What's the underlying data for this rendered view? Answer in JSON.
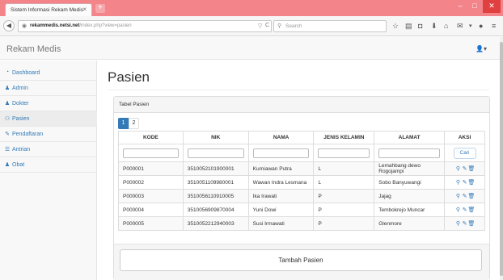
{
  "browser": {
    "tab_title": "Sistem Informasi Rekam Medis",
    "url_host": "rekammedis.netsi.net",
    "url_path": "/index.php?view=pasien",
    "search_placeholder": "Search"
  },
  "app": {
    "brand": "Rekam Medis"
  },
  "sidebar": {
    "items": [
      {
        "label": "Dashboard",
        "icon": "dashboard-icon"
      },
      {
        "label": "Admin",
        "icon": "user-icon"
      },
      {
        "label": "Dokter",
        "icon": "user-icon"
      },
      {
        "label": "Pasien",
        "icon": "users-icon"
      },
      {
        "label": "Pendaftaran",
        "icon": "edit-icon"
      },
      {
        "label": "Antrian",
        "icon": "list-icon"
      },
      {
        "label": "Obat",
        "icon": "user-icon"
      }
    ]
  },
  "main": {
    "title": "Pasien",
    "panel_title": "Tabel Pasien",
    "pagination": [
      "1",
      "2"
    ],
    "columns": [
      "KODE",
      "NIK",
      "NAMA",
      "JENIS KELAMIN",
      "ALAMAT",
      "AKSI"
    ],
    "search_button": "Cari",
    "rows": [
      {
        "kode": "P000001",
        "nik": "3510052101900001",
        "nama": "Kurniawan Putra",
        "jk": "L",
        "alamat": "Lemahbang dewo Rogojampi"
      },
      {
        "kode": "P000002",
        "nik": "3510051109980001",
        "nama": "Wawan Indra Lesmana",
        "jk": "L",
        "alamat": "Sobo Banyuwangi"
      },
      {
        "kode": "P000003",
        "nik": "3510056110910005",
        "nama": "Ika Irawati",
        "jk": "P",
        "alamat": "Jajag"
      },
      {
        "kode": "P000004",
        "nik": "3510056909870004",
        "nama": "Yuni Dowi",
        "jk": "P",
        "alamat": "Tembokrejo Muncar"
      },
      {
        "kode": "P000005",
        "nik": "3510052212940003",
        "nama": "Susi Irmawati",
        "jk": "P",
        "alamat": "Glenmore"
      }
    ],
    "add_button": "Tambah Pasien"
  },
  "colors": {
    "accent": "#337ab7",
    "titlebar": "#f2848a",
    "close": "#e0403f"
  }
}
